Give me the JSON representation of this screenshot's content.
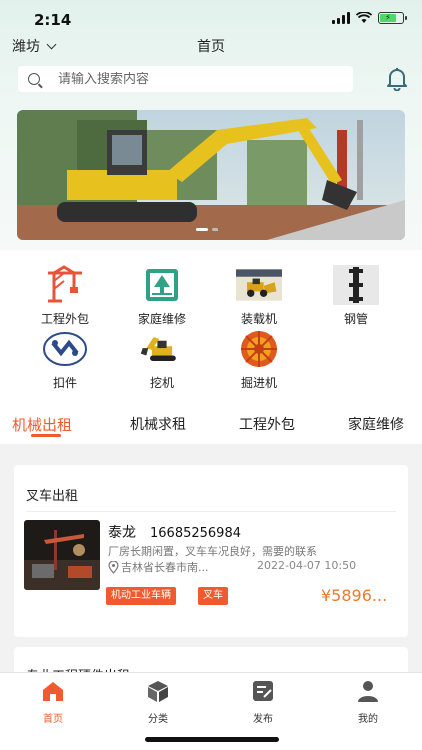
{
  "status": {
    "time": "2:14"
  },
  "nav": {
    "city": "潍坊",
    "title": "首页"
  },
  "search": {
    "placeholder": "请输入搜索内容"
  },
  "categories": [
    {
      "label": "工程外包",
      "icon": "crane-icon"
    },
    {
      "label": "家庭维修",
      "icon": "house-picture-icon"
    },
    {
      "label": "装载机",
      "icon": "loader-icon"
    },
    {
      "label": "钢管",
      "icon": "steel-pipe-icon"
    },
    {
      "label": "扣件",
      "icon": "fastener-icon"
    },
    {
      "label": "挖机",
      "icon": "excavator-icon"
    },
    {
      "label": "掘进机",
      "icon": "tunnel-boring-machine-icon"
    }
  ],
  "tabs": [
    {
      "label": "机械出租",
      "active": true
    },
    {
      "label": "机械求租",
      "active": false
    },
    {
      "label": "工程外包",
      "active": false
    },
    {
      "label": "家庭维修",
      "active": false
    }
  ],
  "listing": {
    "section_title": "叉车出租",
    "name": "泰龙",
    "phone": "16685256984",
    "description": "厂房长期闲置，叉车车况良好，需要的联系",
    "location": "吉林省长春市南...",
    "date": "2022-04-07 10:50",
    "tags": [
      "机动工业车辆",
      "叉车"
    ],
    "price": "¥5896..."
  },
  "next_section": {
    "title": "专业工程硬件出租"
  },
  "tabbar": [
    {
      "label": "首页",
      "icon": "home-icon",
      "active": true
    },
    {
      "label": "分类",
      "icon": "category-box-icon",
      "active": false
    },
    {
      "label": "发布",
      "icon": "publish-icon",
      "active": false
    },
    {
      "label": "我的",
      "icon": "user-icon",
      "active": false
    }
  ],
  "colors": {
    "accent": "#ef5b2e",
    "price": "#ef7a2e",
    "header_bg": "#e2f1ec"
  }
}
